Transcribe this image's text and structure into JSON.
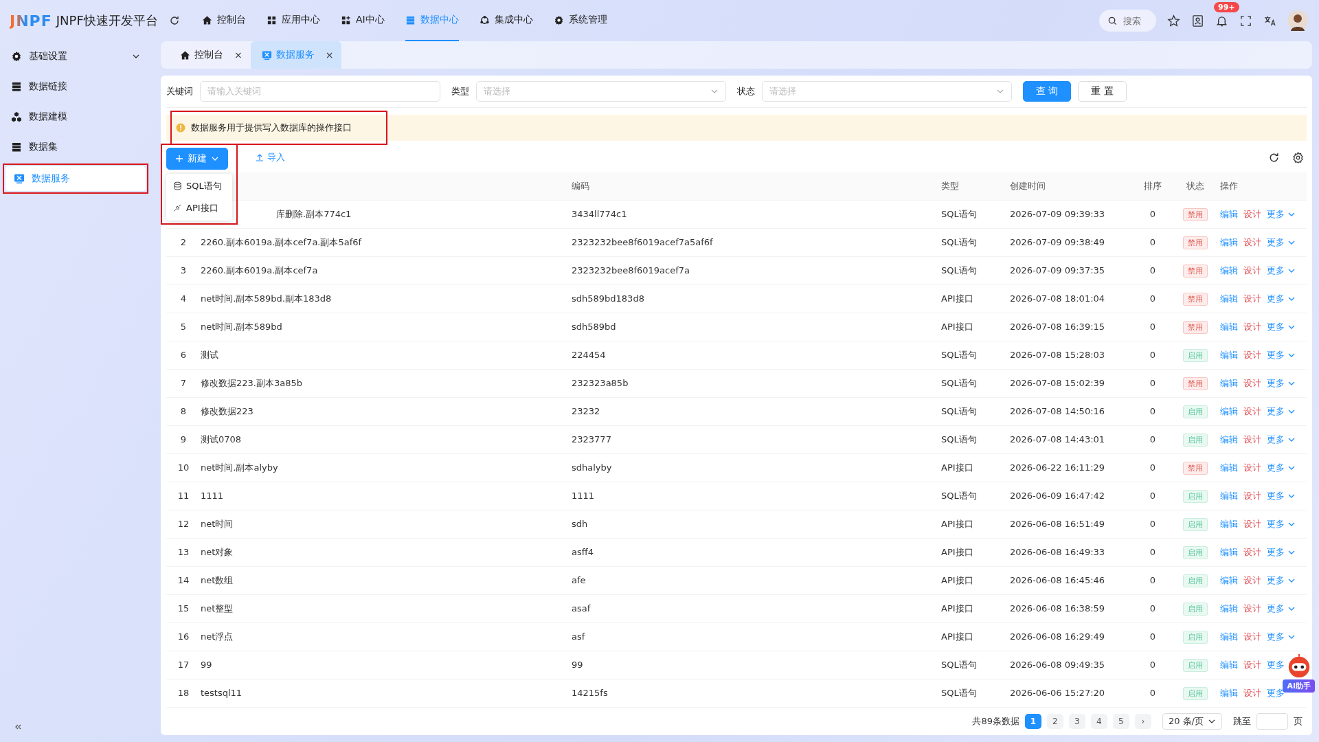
{
  "header": {
    "logo": "JNPF",
    "title": "JNPF快速开发平台",
    "nav": [
      {
        "label": "控制台",
        "selected": false
      },
      {
        "label": "应用中心",
        "selected": false
      },
      {
        "label": "AI中心",
        "selected": false
      },
      {
        "label": "数据中心",
        "selected": true
      },
      {
        "label": "集成中心",
        "selected": false
      },
      {
        "label": "系统管理",
        "selected": false
      }
    ],
    "search_placeholder": "搜索",
    "badge": "99+"
  },
  "sidebar": {
    "items": [
      {
        "label": "基础设置",
        "expandable": true,
        "selected": false
      },
      {
        "label": "数据链接",
        "expandable": false,
        "selected": false
      },
      {
        "label": "数据建模",
        "expandable": false,
        "selected": false
      },
      {
        "label": "数据集",
        "expandable": false,
        "selected": false
      },
      {
        "label": "数据服务",
        "expandable": false,
        "selected": true
      }
    ]
  },
  "tabs": [
    {
      "label": "控制台",
      "close": "×",
      "selected": false
    },
    {
      "label": "数据服务",
      "close": "×",
      "selected": true
    }
  ],
  "filters": {
    "keyword_label": "关键词",
    "keyword_placeholder": "请输入关键词",
    "type_label": "类型",
    "type_placeholder": "请选择",
    "status_label": "状态",
    "status_placeholder": "请选择",
    "query_button": "查 询",
    "reset_button": "重 置"
  },
  "alert": "数据服务用于提供写入数据库的操作接口",
  "toolbar": {
    "new_button": "新建",
    "import_button": "导入",
    "new_menu_open": true,
    "new_menu": [
      "SQL语句",
      "API接口"
    ]
  },
  "table": {
    "columns": [
      "编码",
      "类型",
      "创建时间",
      "排序",
      "状态",
      "操作"
    ],
    "rows": [
      {
        "name": "库删除.副本774c1",
        "code": "3434ll774c1",
        "type": "SQL语句",
        "time": "2026-07-09 09:39:33",
        "sort": "0",
        "status": "禁用",
        "enabled": false,
        "actions": [
          "编辑",
          "设计",
          "更多"
        ]
      },
      {
        "index": "2",
        "name": "2260.副本6019a.副本cef7a.副本5af6f",
        "code": "2323232bee8f6019acef7a5af6f",
        "type": "SQL语句",
        "time": "2026-07-09 09:38:49",
        "sort": "0",
        "status": "禁用",
        "enabled": false,
        "actions": [
          "编辑",
          "设计",
          "更多"
        ]
      },
      {
        "index": "3",
        "name": "2260.副本6019a.副本cef7a",
        "code": "2323232bee8f6019acef7a",
        "type": "SQL语句",
        "time": "2026-07-09 09:37:35",
        "sort": "0",
        "status": "禁用",
        "enabled": false,
        "actions": [
          "编辑",
          "设计",
          "更多"
        ]
      },
      {
        "index": "4",
        "name": "net时间.副本589bd.副本183d8",
        "code": "sdh589bd183d8",
        "type": "API接口",
        "time": "2026-07-08 18:01:04",
        "sort": "0",
        "status": "禁用",
        "enabled": false,
        "actions": [
          "编辑",
          "设计",
          "更多"
        ]
      },
      {
        "index": "5",
        "name": "net时间.副本589bd",
        "code": "sdh589bd",
        "type": "API接口",
        "time": "2026-07-08 16:39:15",
        "sort": "0",
        "status": "禁用",
        "enabled": false,
        "actions": [
          "编辑",
          "设计",
          "更多"
        ]
      },
      {
        "index": "6",
        "name": "测试",
        "code": "224454",
        "type": "SQL语句",
        "time": "2026-07-08 15:28:03",
        "sort": "0",
        "status": "启用",
        "enabled": true,
        "actions": [
          "编辑",
          "设计",
          "更多"
        ]
      },
      {
        "index": "7",
        "name": "修改数据223.副本3a85b",
        "code": "232323a85b",
        "type": "SQL语句",
        "time": "2026-07-08 15:02:39",
        "sort": "0",
        "status": "禁用",
        "enabled": false,
        "actions": [
          "编辑",
          "设计",
          "更多"
        ]
      },
      {
        "index": "8",
        "name": "修改数据223",
        "code": "23232",
        "type": "SQL语句",
        "time": "2026-07-08 14:50:16",
        "sort": "0",
        "status": "启用",
        "enabled": true,
        "actions": [
          "编辑",
          "设计",
          "更多"
        ]
      },
      {
        "index": "9",
        "name": "测试0708",
        "code": "2323777",
        "type": "SQL语句",
        "time": "2026-07-08 14:43:01",
        "sort": "0",
        "status": "启用",
        "enabled": true,
        "actions": [
          "编辑",
          "设计",
          "更多"
        ]
      },
      {
        "index": "10",
        "name": "net时间.副本alyby",
        "code": "sdhalyby",
        "type": "API接口",
        "time": "2026-06-22 16:11:29",
        "sort": "0",
        "status": "禁用",
        "enabled": false,
        "actions": [
          "编辑",
          "设计",
          "更多"
        ]
      },
      {
        "index": "11",
        "name": "1111",
        "code": "1111",
        "type": "SQL语句",
        "time": "2026-06-09 16:47:42",
        "sort": "0",
        "status": "启用",
        "enabled": true,
        "actions": [
          "编辑",
          "设计",
          "更多"
        ]
      },
      {
        "index": "12",
        "name": "net时间",
        "code": "sdh",
        "type": "API接口",
        "time": "2026-06-08 16:51:49",
        "sort": "0",
        "status": "启用",
        "enabled": true,
        "actions": [
          "编辑",
          "设计",
          "更多"
        ]
      },
      {
        "index": "13",
        "name": "net对象",
        "code": "asff4",
        "type": "API接口",
        "time": "2026-06-08 16:49:33",
        "sort": "0",
        "status": "启用",
        "enabled": true,
        "actions": [
          "编辑",
          "设计",
          "更多"
        ]
      },
      {
        "index": "14",
        "name": "net数组",
        "code": "afe",
        "type": "API接口",
        "time": "2026-06-08 16:45:46",
        "sort": "0",
        "status": "启用",
        "enabled": true,
        "actions": [
          "编辑",
          "设计",
          "更多"
        ]
      },
      {
        "index": "15",
        "name": "net整型",
        "code": "asaf",
        "type": "API接口",
        "time": "2026-06-08 16:38:59",
        "sort": "0",
        "status": "启用",
        "enabled": true,
        "actions": [
          "编辑",
          "设计",
          "更多"
        ]
      },
      {
        "index": "16",
        "name": "net浮点",
        "code": "asf",
        "type": "API接口",
        "time": "2026-06-08 16:29:49",
        "sort": "0",
        "status": "启用",
        "enabled": true,
        "actions": [
          "编辑",
          "设计",
          "更多"
        ]
      },
      {
        "index": "17",
        "name": "99",
        "code": "99",
        "type": "SQL语句",
        "time": "2026-06-08 09:49:35",
        "sort": "0",
        "status": "启用",
        "enabled": true,
        "actions": [
          "编辑",
          "设计",
          "更多"
        ]
      },
      {
        "index": "18",
        "name": "testsql11",
        "code": "14215fs",
        "type": "SQL语句",
        "time": "2026-06-06 15:27:20",
        "sort": "0",
        "status": "启用",
        "enabled": true,
        "actions": [
          "编辑",
          "设计",
          "更多"
        ]
      }
    ]
  },
  "pagination": {
    "total": "共89条数据",
    "pages": [
      {
        "label": "1",
        "selected": true
      },
      {
        "label": "2",
        "selected": false
      },
      {
        "label": "3",
        "selected": false
      },
      {
        "label": "4",
        "selected": false
      },
      {
        "label": "5",
        "selected": false
      }
    ],
    "next": "›",
    "page_size": "20 条/页",
    "jump_label": "跳至",
    "page_suffix": "页"
  },
  "assistant": {
    "label": "AI助手"
  }
}
